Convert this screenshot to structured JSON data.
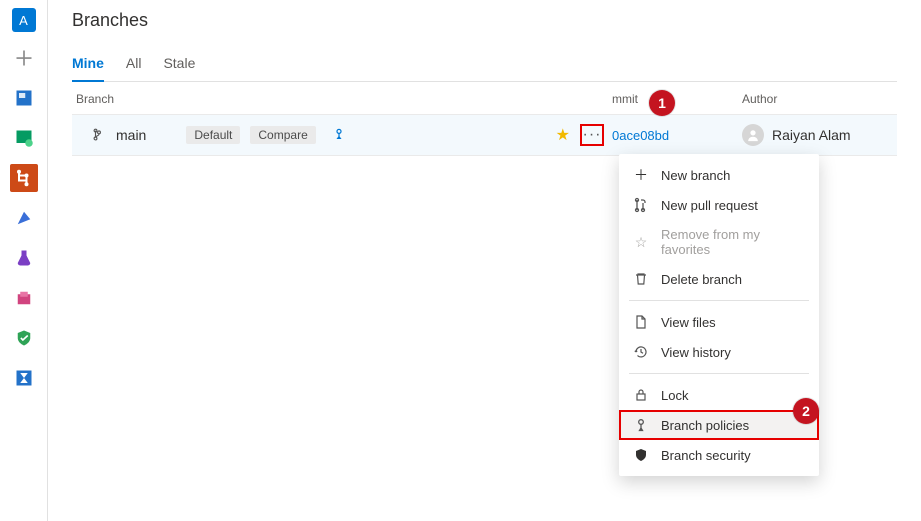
{
  "project_initial": "A",
  "page_title": "Branches",
  "tabs": [
    {
      "label": "Mine",
      "active": true
    },
    {
      "label": "All",
      "active": false
    },
    {
      "label": "Stale",
      "active": false
    }
  ],
  "columns": {
    "branch": "Branch",
    "commit": "mmit",
    "author": "Author"
  },
  "row": {
    "name": "main",
    "badges": [
      "Default",
      "Compare"
    ],
    "commit": "0ace08bd",
    "author": "Raiyan Alam"
  },
  "menu": {
    "new_branch": "New branch",
    "new_pr": "New pull request",
    "remove_fav": "Remove from my favorites",
    "delete": "Delete branch",
    "view_files": "View files",
    "view_history": "View history",
    "lock": "Lock",
    "policies": "Branch policies",
    "security": "Branch security"
  },
  "callouts": {
    "c1": "1",
    "c2": "2"
  }
}
